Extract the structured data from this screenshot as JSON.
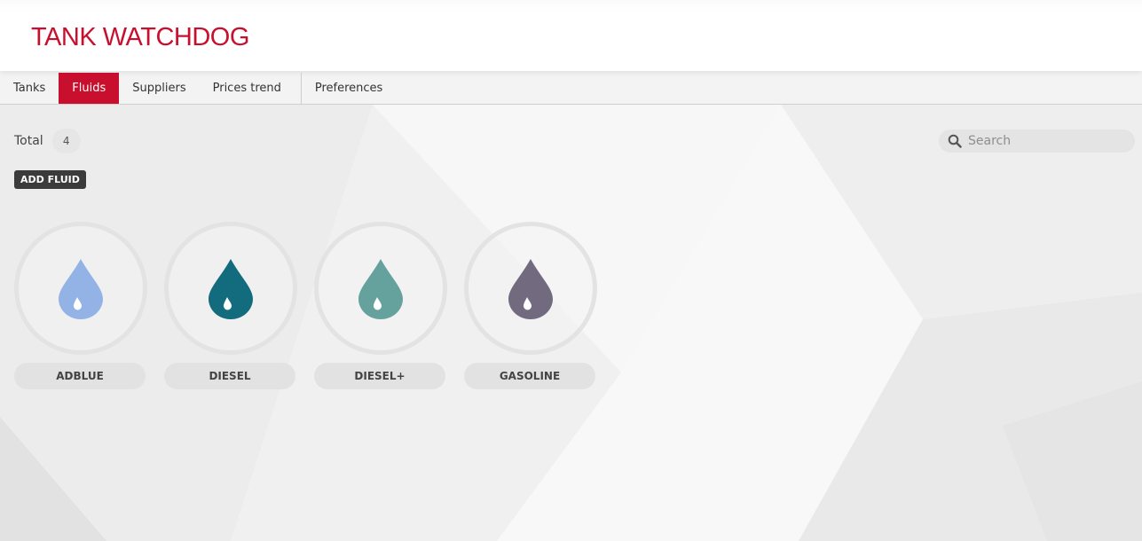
{
  "app": {
    "title": "TANK WATCHDOG"
  },
  "nav": {
    "tabs": [
      {
        "label": "Tanks",
        "active": false
      },
      {
        "label": "Fluids",
        "active": true
      },
      {
        "label": "Suppliers",
        "active": false
      },
      {
        "label": "Prices trend",
        "active": false
      },
      {
        "label": "Preferences",
        "active": false
      }
    ]
  },
  "summary": {
    "total_label": "Total",
    "total_count": "4"
  },
  "actions": {
    "add_fluid_label": "ADD FLUID"
  },
  "search": {
    "placeholder": "Search",
    "icon": "search-icon"
  },
  "fluids": [
    {
      "name": "ADBLUE",
      "color": "#93b3e6",
      "icon": "drop-icon"
    },
    {
      "name": "DIESEL",
      "color": "#136b7e",
      "icon": "drop-icon"
    },
    {
      "name": "DIESEL+",
      "color": "#65a29e",
      "icon": "drop-icon"
    },
    {
      "name": "GASOLINE",
      "color": "#726b80",
      "icon": "drop-icon"
    }
  ],
  "colors": {
    "brand": "#c8102e",
    "active_tab": "#c8102e"
  }
}
